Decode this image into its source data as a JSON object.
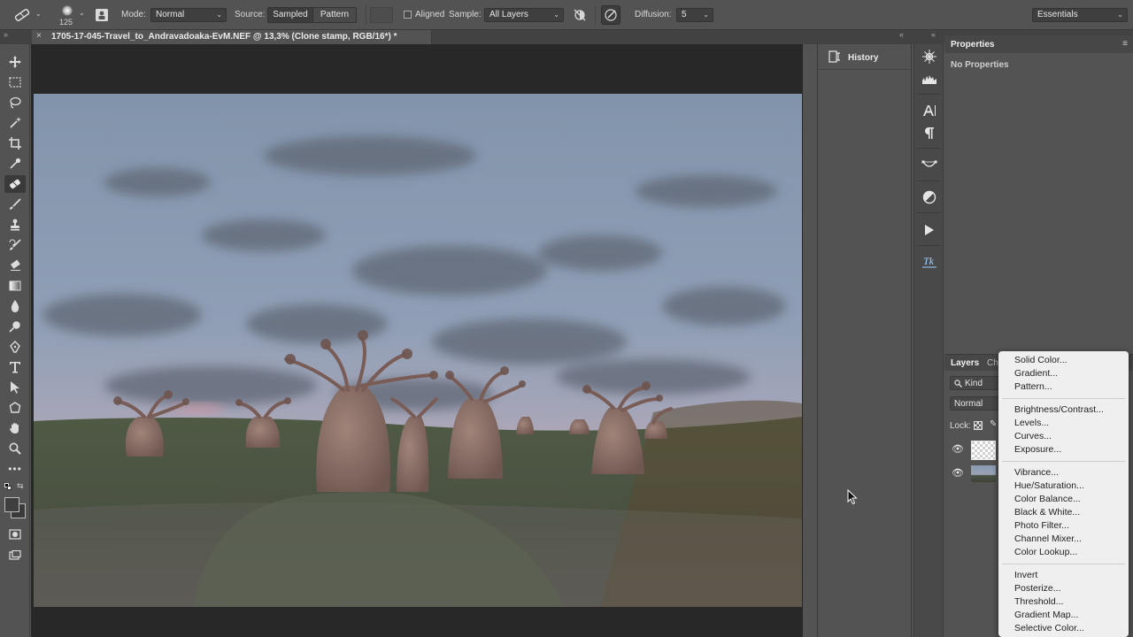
{
  "options_bar": {
    "brush_size": "125",
    "mode_label": "Mode:",
    "mode_value": "Normal",
    "source_label": "Source:",
    "source_sampled": "Sampled",
    "source_pattern": "Pattern",
    "aligned_label": "Aligned",
    "sample_label": "Sample:",
    "sample_value": "All Layers",
    "diffusion_label": "Diffusion:",
    "diffusion_value": "5",
    "workspace_value": "Essentials"
  },
  "document": {
    "tab_title": "1705-17-045-Travel_to_Andravadoaka-EvM.NEF @ 13,3% (Clone stamp, RGB/16*) *",
    "close_glyph": "×"
  },
  "history": {
    "label": "History"
  },
  "properties": {
    "title": "Properties",
    "empty_text": "No Properties"
  },
  "layers": {
    "tab_layers": "Layers",
    "tab_channels": "Ch",
    "filter_kind": "Kind",
    "blend_mode": "Normal",
    "lock_label": "Lock:"
  },
  "adjustment_menu": {
    "group1": [
      "Solid Color...",
      "Gradient...",
      "Pattern..."
    ],
    "group2": [
      "Brightness/Contrast...",
      "Levels...",
      "Curves...",
      "Exposure..."
    ],
    "group3": [
      "Vibrance...",
      "Hue/Saturation...",
      "Color Balance...",
      "Black & White...",
      "Photo Filter...",
      "Channel Mixer...",
      "Color Lookup..."
    ],
    "group4": [
      "Invert",
      "Posterize...",
      "Threshold...",
      "Gradient Map...",
      "Selective Color..."
    ]
  },
  "toolbar_icons": [
    "move-icon",
    "marquee-icon",
    "lasso-icon",
    "magic-wand-icon",
    "crop-icon",
    "eyedropper-icon",
    "healing-brush-icon",
    "brush-icon",
    "clone-stamp-icon",
    "history-brush-icon",
    "eraser-icon",
    "gradient-icon",
    "blur-icon",
    "dodge-icon",
    "pen-icon",
    "type-icon",
    "path-selection-icon",
    "shape-icon",
    "hand-icon",
    "zoom-icon",
    "more-tools-icon"
  ],
  "side_icons": [
    "navigator-icon",
    "histogram-icon",
    "character-icon",
    "paragraph-icon",
    "paths-icon",
    "adjustments-icon",
    "actions-icon",
    "plugin-tk-icon"
  ],
  "colors": {
    "panel_bg": "#535353",
    "pasteboard": "#282828",
    "menu_bg": "#efefef"
  }
}
